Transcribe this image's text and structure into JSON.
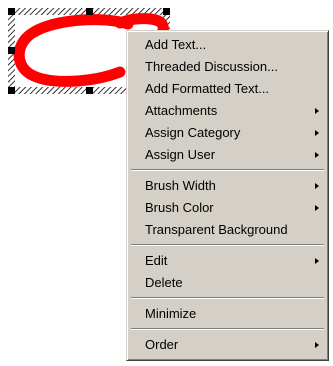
{
  "annotation": {
    "stroke_color": "#ff0000",
    "handle_color": "#000000"
  },
  "context_menu": {
    "groups": [
      {
        "items": [
          {
            "label": "Add Text...",
            "submenu": false
          },
          {
            "label": "Threaded Discussion...",
            "submenu": false
          },
          {
            "label": "Add Formatted Text...",
            "submenu": false
          },
          {
            "label": "Attachments",
            "submenu": true
          },
          {
            "label": "Assign Category",
            "submenu": true
          },
          {
            "label": "Assign User",
            "submenu": true
          }
        ]
      },
      {
        "items": [
          {
            "label": "Brush Width",
            "submenu": true
          },
          {
            "label": "Brush Color",
            "submenu": true
          },
          {
            "label": "Transparent Background",
            "submenu": false
          }
        ]
      },
      {
        "items": [
          {
            "label": "Edit",
            "submenu": true
          },
          {
            "label": "Delete",
            "submenu": false
          }
        ]
      },
      {
        "items": [
          {
            "label": "Minimize",
            "submenu": false
          }
        ]
      },
      {
        "items": [
          {
            "label": "Order",
            "submenu": true
          }
        ]
      }
    ]
  }
}
